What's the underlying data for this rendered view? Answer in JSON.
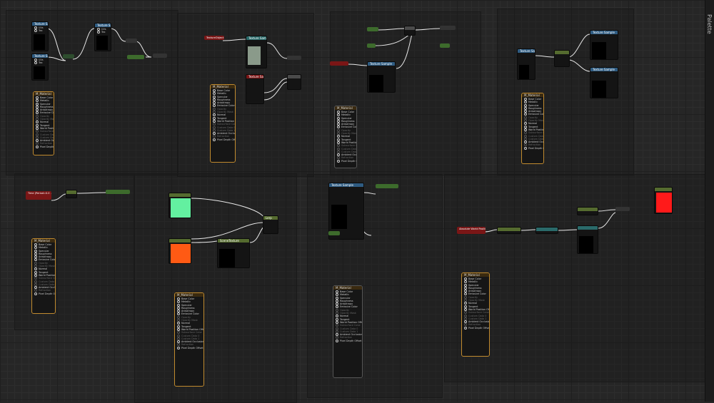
{
  "palette_tab": {
    "label": "Palette"
  },
  "nodes": {
    "ts_a1": {
      "title": "Texture Sample",
      "pins": [
        "UVs",
        "Tex",
        "Apply View MipBias"
      ]
    },
    "ts_a2": {
      "title": "Texture Sample",
      "pins": [
        "UVs",
        "Tex",
        "Apply View MipBias"
      ]
    },
    "ts_a3": {
      "title": "Texture Sample",
      "pins": [
        "UVs",
        "Tex",
        "Apply View MipBias"
      ]
    },
    "texobj_b": {
      "title": "TextureObject",
      "sub": "Texture Obj..."
    },
    "ts_b": {
      "title": "Texture Sample",
      "sub": "Apply View MipBias",
      "pins": [
        "UVs",
        "Tex",
        "Apply View MipBias"
      ]
    },
    "ts_b2": {
      "title": "Texture Sample",
      "pins": [
        "UVs",
        "Tex",
        "Apply View MipBias"
      ]
    },
    "ts_c": {
      "title": "Texture Sample",
      "pins": [
        "UVs",
        "Tex",
        "Apply View MipBias"
      ]
    },
    "ts_d1": {
      "title": "Texture Sample",
      "pins": [
        "UVs",
        "Tex",
        "Apply View MipBias"
      ]
    },
    "ts_d2": {
      "title": "Texture Sample",
      "pins": [
        "UVs",
        "Tex",
        "Apply View MipBias"
      ]
    },
    "ts_d3": {
      "title": "Texture Sample",
      "pins": [
        "UVs",
        "Tex",
        "Apply View MipBias"
      ]
    },
    "ts_e": {
      "title": "Texture Sample",
      "pins": [
        "UVs",
        "Tex",
        "Apply View MipBias"
      ]
    },
    "time_node": {
      "title": "Time (Period=0.0 ...)"
    },
    "lerp_node": {
      "title": "Lerp",
      "pins": [
        "A",
        "B",
        "Alpha"
      ]
    },
    "param_node": {
      "title": "SceneTexture",
      "pins": [
        "UVs"
      ]
    },
    "break_out": {
      "title": "Break Out Float4 Components"
    },
    "world_pos": {
      "title": "Absolute World Position"
    },
    "vec_param": {
      "title": "VectorParameter",
      "sub": "Default Value"
    },
    "red_const": {
      "title": "Param (1)"
    }
  },
  "material_pins": [
    "Base Color",
    "Metallic",
    "Specular",
    "Roughness",
    "Anisotropy",
    "Emissive Color",
    "Opacity",
    "Opacity Mask",
    "Normal",
    "Tangent",
    "World Position Offset",
    "Subsurface Color",
    "Custom Data 0",
    "Custom Data 1",
    "Ambient Occlusion",
    "Refraction",
    "Pixel Depth Offset"
  ],
  "material_title": "M_Material",
  "colors": {
    "green_swatch": "#63f0a0",
    "orange_swatch": "#ff5a14",
    "red_swatch": "#ff1a1a",
    "accent_orange": "#c08a2e",
    "texture_blue": "#2f5c82"
  }
}
